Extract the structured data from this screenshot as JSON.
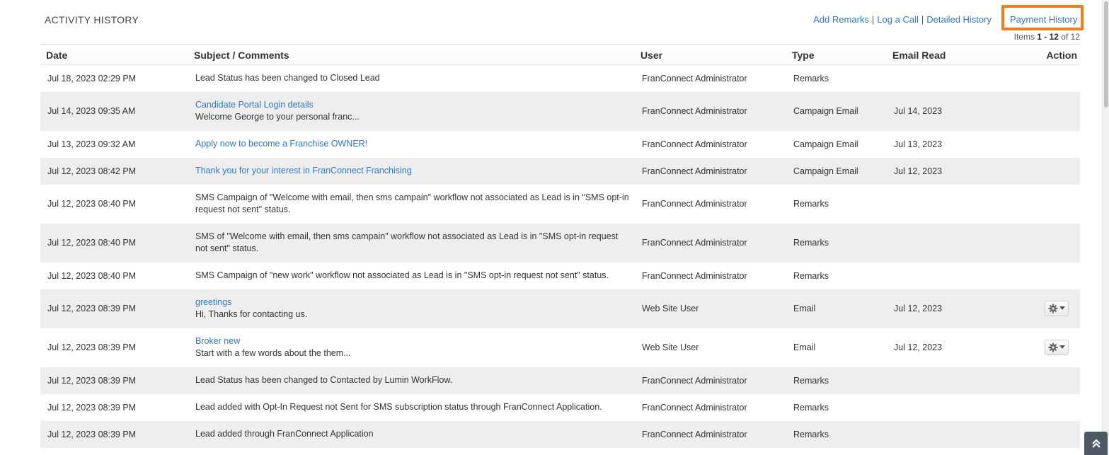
{
  "section": {
    "title": "ACTIVITY HISTORY"
  },
  "links": {
    "add_remarks": "Add Remarks",
    "log_call": "Log a Call",
    "detailed_history": "Detailed History",
    "payment_history": "Payment History",
    "separator": "|"
  },
  "pagination": {
    "prefix": "Items ",
    "range": "1 - 12",
    "suffix": " of 12"
  },
  "columns": {
    "date": "Date",
    "subject": "Subject / Comments",
    "user": "User",
    "type": "Type",
    "email_read": "Email Read",
    "action": "Action"
  },
  "rows": [
    {
      "date": "Jul 18, 2023 02:29 PM",
      "subject_link": "",
      "subject_text": "Lead Status has been changed to Closed Lead",
      "user": "FranConnect Administrator",
      "type": "Remarks",
      "email_read": ""
    },
    {
      "date": "Jul 14, 2023 09:35 AM",
      "subject_link": "Candidate Portal Login details",
      "subject_text": "Welcome George to your personal franc...",
      "user": "FranConnect Administrator",
      "type": "Campaign Email",
      "email_read": "Jul 14, 2023"
    },
    {
      "date": "Jul 13, 2023 09:32 AM",
      "subject_link": "Apply now to become a Franchise OWNER!",
      "subject_text": "",
      "user": "FranConnect Administrator",
      "type": "Campaign Email",
      "email_read": "Jul 13, 2023"
    },
    {
      "date": "Jul 12, 2023 08:42 PM",
      "subject_link": "Thank you for your interest in FranConnect Franchising",
      "subject_text": "",
      "user": "FranConnect Administrator",
      "type": "Campaign Email",
      "email_read": "Jul 12, 2023"
    },
    {
      "date": "Jul 12, 2023 08:40 PM",
      "subject_link": "",
      "subject_text": "SMS Campaign of \"Welcome with email, then sms campain\" workflow not associated as Lead is in \"SMS opt-in request not sent\" status.",
      "user": "FranConnect Administrator",
      "type": "Remarks",
      "email_read": ""
    },
    {
      "date": "Jul 12, 2023 08:40 PM",
      "subject_link": "",
      "subject_text": "SMS of \"Welcome with email, then sms campain\" workflow not associated as Lead is in \"SMS opt-in request not sent\" status.",
      "user": "FranConnect Administrator",
      "type": "Remarks",
      "email_read": ""
    },
    {
      "date": "Jul 12, 2023 08:40 PM",
      "subject_link": "",
      "subject_text": "SMS Campaign of \"new work\" workflow not associated as Lead is in \"SMS opt-in request not sent\" status.",
      "user": "FranConnect Administrator",
      "type": "Remarks",
      "email_read": ""
    },
    {
      "date": "Jul 12, 2023 08:39 PM",
      "subject_link": "greetings",
      "subject_text": "Hi, Thanks for contacting us.",
      "user": "Web Site User",
      "type": "Email",
      "email_read": "Jul 12, 2023",
      "action_icon": "gear-dropdown-icon"
    },
    {
      "date": "Jul 12, 2023 08:39 PM",
      "subject_link": "Broker new",
      "subject_text": "Start with a few words about the them...",
      "user": "Web Site User",
      "type": "Email",
      "email_read": "Jul 12, 2023",
      "action_icon": "gear-dropdown-icon"
    },
    {
      "date": "Jul 12, 2023 08:39 PM",
      "subject_link": "",
      "subject_text": "Lead Status has been changed to Contacted by Lumin WorkFlow.",
      "user": "FranConnect Administrator",
      "type": "Remarks",
      "email_read": ""
    },
    {
      "date": "Jul 12, 2023 08:39 PM",
      "subject_link": "",
      "subject_text": "Lead added with Opt-In Request not Sent for SMS subscription status through FranConnect Application.",
      "user": "FranConnect Administrator",
      "type": "Remarks",
      "email_read": ""
    },
    {
      "date": "Jul 12, 2023 08:39 PM",
      "subject_link": "",
      "subject_text": "Lead added through FranConnect Application",
      "user": "FranConnect Administrator",
      "type": "Remarks",
      "email_read": ""
    }
  ],
  "colors": {
    "link": "#2f77c6",
    "highlight": "#f07e1a",
    "alt_row": "#eeeeee"
  },
  "icons": {
    "scroll_top": "double-chevron-up-icon",
    "row_action": "gear-icon"
  }
}
